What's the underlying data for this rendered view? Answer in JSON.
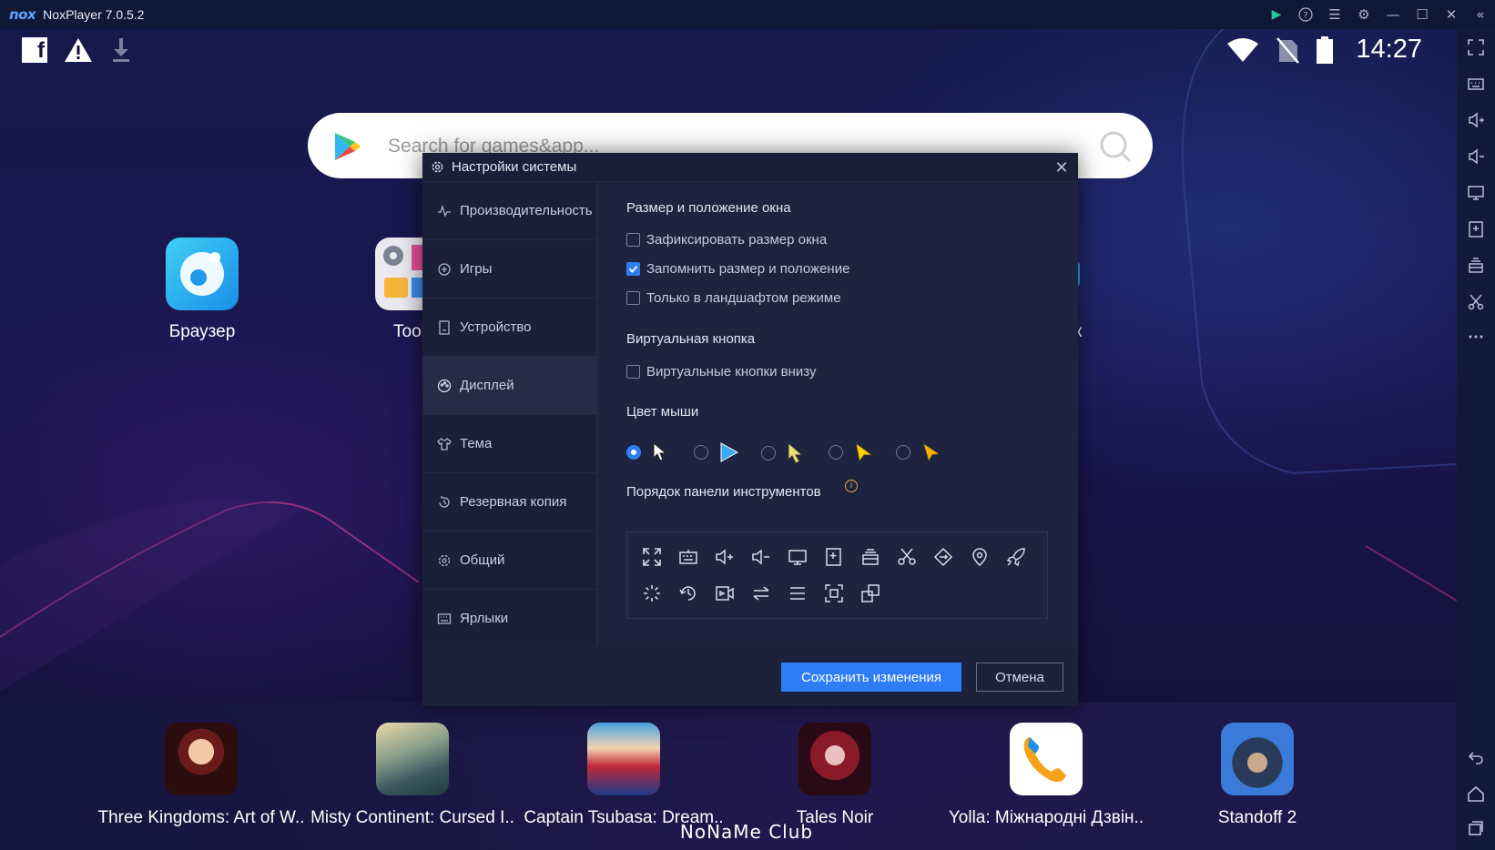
{
  "window": {
    "logo": "nox",
    "title": "NoxPlayer 7.0.5.2"
  },
  "statusbar": {
    "time": "14:27",
    "icons": [
      "facebook-icon",
      "warning-icon",
      "download-icon",
      "wifi-icon",
      "no-sim-icon",
      "battery-icon"
    ]
  },
  "search": {
    "placeholder": "Search for games&app..."
  },
  "desktop": {
    "apps": [
      {
        "label": "Браузер",
        "icon": "browser-icon"
      },
      {
        "label": "Tool",
        "icon": "tools-folder-icon"
      },
      {
        "label": "к",
        "icon": "app-icon"
      }
    ]
  },
  "dock": {
    "apps": [
      {
        "label": "Three Kingdoms: Art of W..",
        "icon": "three-kingdoms-icon"
      },
      {
        "label": "Misty Continent: Cursed I..",
        "icon": "misty-continent-icon"
      },
      {
        "label": "Captain Tsubasa: Dream..",
        "icon": "captain-tsubasa-icon"
      },
      {
        "label": "Tales Noir",
        "icon": "tales-noir-icon"
      },
      {
        "label": "Yolla: Міжнародні Дзвін..",
        "icon": "yolla-icon"
      },
      {
        "label": "Standoff 2",
        "icon": "standoff-icon"
      }
    ],
    "watermark": "NoNaMe Club"
  },
  "dialog": {
    "title": "Настройки системы",
    "nav": [
      {
        "label": "Производительность",
        "icon": "performance-icon",
        "active": false
      },
      {
        "label": "Игры",
        "icon": "games-icon",
        "active": false
      },
      {
        "label": "Устройство",
        "icon": "device-icon",
        "active": false
      },
      {
        "label": "Дисплей",
        "icon": "display-icon",
        "active": true
      },
      {
        "label": "Тема",
        "icon": "theme-icon",
        "active": false
      },
      {
        "label": "Резервная копия",
        "icon": "backup-icon",
        "active": false
      },
      {
        "label": "Общий",
        "icon": "general-icon",
        "active": false
      },
      {
        "label": "Ярлыки",
        "icon": "shortcuts-icon",
        "active": false
      }
    ],
    "sections": {
      "window": {
        "title": "Размер и положение окна",
        "options": [
          {
            "label": "Зафиксировать размер окна",
            "checked": false
          },
          {
            "label": "Запомнить размер и положение",
            "checked": true
          },
          {
            "label": "Только в ландшафтом режиме",
            "checked": false
          }
        ]
      },
      "virtual": {
        "title": "Виртуальная кнопка",
        "options": [
          {
            "label": "Виртуальные кнопки внизу",
            "checked": false
          }
        ]
      },
      "mouse": {
        "title": "Цвет мыши",
        "cursor_colors": [
          "#ffffff",
          "#3aa8f0",
          "#e8e070",
          "#ffd000",
          "#ffae00"
        ],
        "selected_index": 0
      },
      "toolbar": {
        "title": "Порядок панели инструментов",
        "row1": [
          "fullscreen-icon",
          "keyboard-icon",
          "volume-up-icon",
          "volume-down-icon",
          "screen-icon",
          "apk-icon",
          "multi-instance-icon",
          "scissors-icon",
          "rotate-icon",
          "location-icon",
          "rocket-icon"
        ],
        "row2": [
          "loading-icon",
          "macro-record-icon",
          "video-record-icon",
          "swap-icon",
          "menu-icon",
          "screenshot-icon",
          "multi-window-icon"
        ]
      }
    },
    "buttons": {
      "save": "Сохранить изменения",
      "cancel": "Отмена"
    }
  },
  "colors": {
    "accent": "#2f7df6",
    "dialog_bg": "#1e2440",
    "nav_active": "#262c48"
  }
}
